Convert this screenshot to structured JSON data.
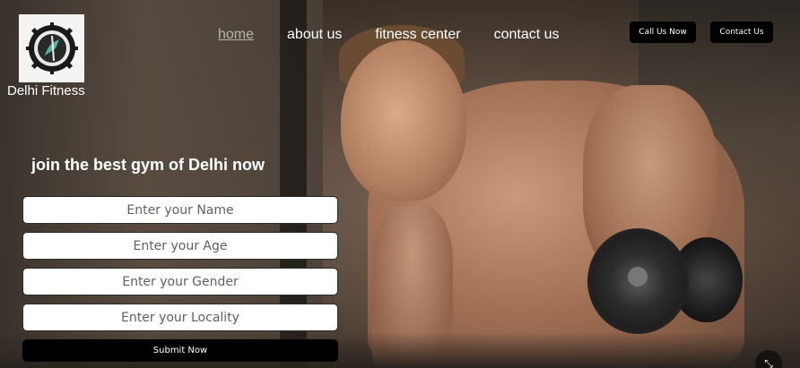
{
  "brand": {
    "name": "Delhi Fitness"
  },
  "nav": {
    "items": [
      {
        "label": "home",
        "active": true
      },
      {
        "label": "about us",
        "active": false
      },
      {
        "label": "fitness center",
        "active": false
      },
      {
        "label": "contact us",
        "active": false
      }
    ]
  },
  "header_buttons": {
    "call_label": "Call Us Now",
    "contact_label": "Contact Us"
  },
  "hero": {
    "headline": "join the best gym of Delhi now"
  },
  "form": {
    "name_placeholder": "Enter your Name",
    "age_placeholder": "Enter your Age",
    "gender_placeholder": "Enter your Gender",
    "locality_placeholder": "Enter your Locality",
    "submit_label": "Submit Now"
  },
  "colors": {
    "button_bg": "#000000",
    "nav_active": "#b9b3ad",
    "text": "#ffffff"
  }
}
